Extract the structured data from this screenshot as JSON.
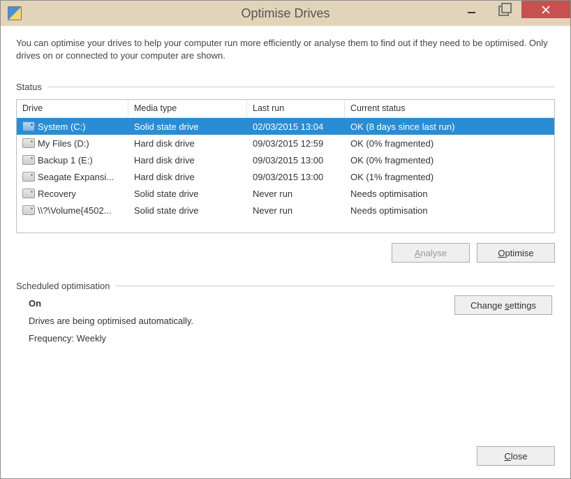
{
  "window": {
    "title": "Optimise Drives"
  },
  "intro": "You can optimise your drives to help your computer run more efficiently or analyse them to find out if they need to be optimised. Only drives on or connected to your computer are shown.",
  "status_label": "Status",
  "columns": {
    "drive": "Drive",
    "media": "Media type",
    "last": "Last run",
    "status": "Current status"
  },
  "drives": [
    {
      "name": "System (C:)",
      "media": "Solid state drive",
      "last": "02/03/2015 13:04",
      "status": "OK (8 days since last run)",
      "selected": true,
      "blue": true
    },
    {
      "name": "My Files (D:)",
      "media": "Hard disk drive",
      "last": "09/03/2015 12:59",
      "status": "OK (0% fragmented)"
    },
    {
      "name": "Backup 1 (E:)",
      "media": "Hard disk drive",
      "last": "09/03/2015 13:00",
      "status": "OK (0% fragmented)"
    },
    {
      "name": "Seagate Expansi...",
      "media": "Hard disk drive",
      "last": "09/03/2015 13:00",
      "status": "OK (1% fragmented)"
    },
    {
      "name": "Recovery",
      "media": "Solid state drive",
      "last": "Never run",
      "status": "Needs optimisation"
    },
    {
      "name": "\\\\?\\Volume{4502...",
      "media": "Solid state drive",
      "last": "Never run",
      "status": "Needs optimisation"
    }
  ],
  "buttons": {
    "analyse_pre": "",
    "analyse_ul": "A",
    "analyse_post": "nalyse",
    "optimise_pre": "",
    "optimise_ul": "O",
    "optimise_post": "ptimise",
    "change_pre": "Change ",
    "change_ul": "s",
    "change_post": "ettings",
    "close_pre": "",
    "close_ul": "C",
    "close_post": "lose"
  },
  "scheduled": {
    "label": "Scheduled optimisation",
    "state": "On",
    "desc": "Drives are being optimised automatically.",
    "freq": "Frequency: Weekly"
  }
}
